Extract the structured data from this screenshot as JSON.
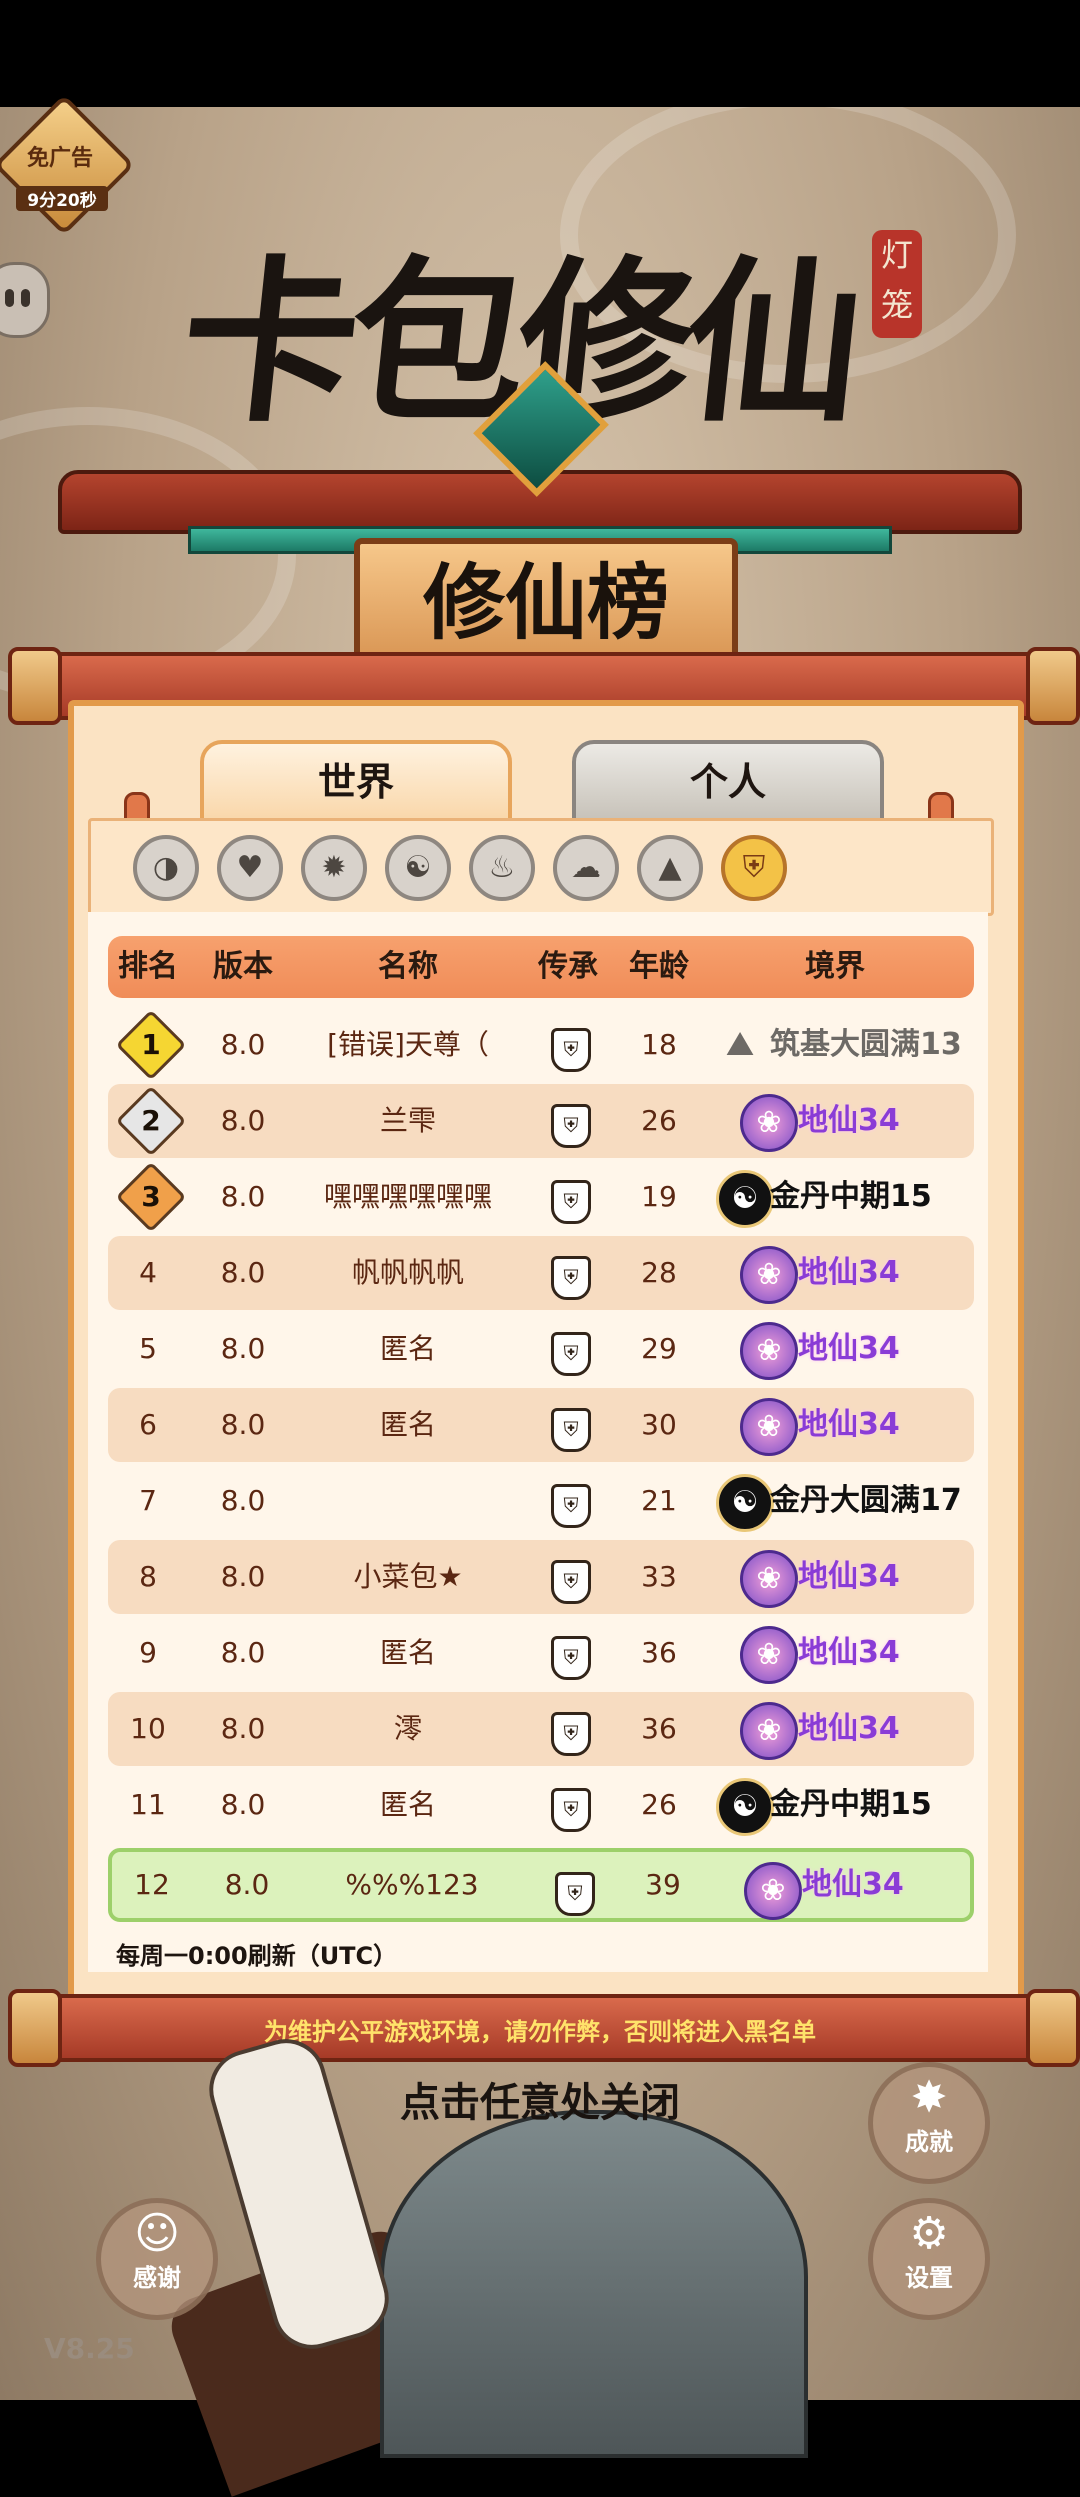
{
  "ad": {
    "label": "免广告",
    "timer": "9分20秒"
  },
  "title": {
    "main": "卡包修仙",
    "seal": "灯笼"
  },
  "leaderboard": {
    "plaque": "修仙榜"
  },
  "tabs": [
    {
      "label": "世界",
      "active": true
    },
    {
      "label": "个人",
      "active": false
    }
  ],
  "filters": [
    {
      "icon": "partial-icon",
      "glyph": "◑"
    },
    {
      "icon": "heart-icon",
      "glyph": "♥"
    },
    {
      "icon": "fire-icon",
      "glyph": "✹"
    },
    {
      "icon": "yinyang-icon",
      "glyph": "☯"
    },
    {
      "icon": "flame-icon",
      "glyph": "♨"
    },
    {
      "icon": "cloud-icon",
      "glyph": "☁"
    },
    {
      "icon": "mountain-icon",
      "glyph": "▲"
    },
    {
      "icon": "shield-icon",
      "glyph": "⛨",
      "active": true
    }
  ],
  "table": {
    "headers": {
      "rank": "排名",
      "version": "版本",
      "name": "名称",
      "inherit": "传承",
      "age": "年龄",
      "realm": "境界"
    },
    "rows": [
      {
        "rank": "1",
        "version": "8.0",
        "name": "[错误]天尊（",
        "age": "18",
        "realm": "筑基大圆满13",
        "realm_type": "grey"
      },
      {
        "rank": "2",
        "version": "8.0",
        "name": "兰雫",
        "age": "26",
        "realm": "地仙34",
        "realm_type": "purple"
      },
      {
        "rank": "3",
        "version": "8.0",
        "name": "嘿嘿嘿嘿嘿嘿",
        "age": "19",
        "realm": "金丹中期15",
        "realm_type": "black"
      },
      {
        "rank": "4",
        "version": "8.0",
        "name": "帆帆帆帆",
        "age": "28",
        "realm": "地仙34",
        "realm_type": "purple"
      },
      {
        "rank": "5",
        "version": "8.0",
        "name": "匿名",
        "age": "29",
        "realm": "地仙34",
        "realm_type": "purple"
      },
      {
        "rank": "6",
        "version": "8.0",
        "name": "匿名",
        "age": "30",
        "realm": "地仙34",
        "realm_type": "purple"
      },
      {
        "rank": "7",
        "version": "8.0",
        "name": "",
        "age": "21",
        "realm": "金丹大圆满17",
        "realm_type": "black"
      },
      {
        "rank": "8",
        "version": "8.0",
        "name": "小菜包★",
        "age": "33",
        "realm": "地仙34",
        "realm_type": "purple"
      },
      {
        "rank": "9",
        "version": "8.0",
        "name": "匿名",
        "age": "36",
        "realm": "地仙34",
        "realm_type": "purple"
      },
      {
        "rank": "10",
        "version": "8.0",
        "name": "澪",
        "age": "36",
        "realm": "地仙34",
        "realm_type": "purple"
      },
      {
        "rank": "11",
        "version": "8.0",
        "name": "匿名",
        "age": "26",
        "realm": "金丹中期15",
        "realm_type": "black"
      }
    ],
    "self_row": {
      "rank": "12",
      "version": "8.0",
      "name": "%%%123",
      "age": "39",
      "realm": "地仙34",
      "realm_type": "purple"
    }
  },
  "refresh_note": "每周一0:00刷新（UTC）",
  "warning": "为维护公平游戏环境，请勿作弊，否则将进入黑名单",
  "close_hint": "点击任意处关闭",
  "buttons": {
    "achievement": "成就",
    "thanks": "感谢",
    "settings": "设置"
  },
  "version": "V8.25",
  "colors": {
    "header": "#f08c58",
    "alt_row": "#f7dcc1",
    "self_row": "#dcf2bc",
    "realm_purple": "#8a3cd6"
  }
}
